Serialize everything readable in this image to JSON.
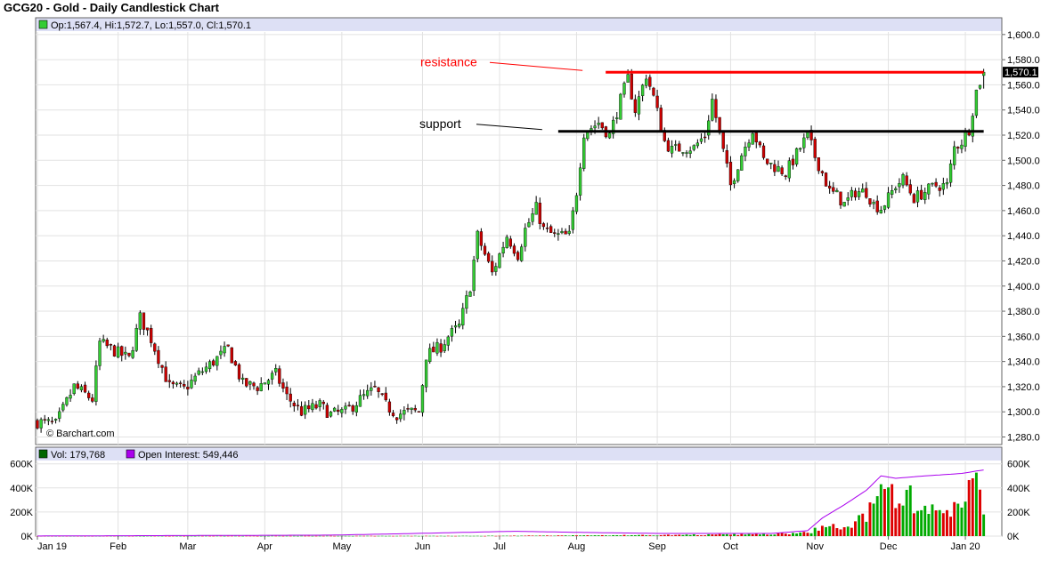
{
  "chart_data": {
    "type": "candlestick",
    "title": "GCG20 - Gold - Daily Candlestick Chart",
    "ohlc_label": "Op:1,567.4, Hi:1,572.7, Lo:1,557.0, Cl:1,570.1",
    "last_price_label": "1,570.1",
    "last_price": 1570.1,
    "watermark": "© Barchart.com",
    "y_ticks": [
      1280,
      1300,
      1320,
      1340,
      1360,
      1380,
      1400,
      1420,
      1440,
      1460,
      1480,
      1500,
      1520,
      1540,
      1560,
      1580,
      1600
    ],
    "y_tick_labels": [
      "1,280.0",
      "1,300.0",
      "1,320.0",
      "1,340.0",
      "1,360.0",
      "1,380.0",
      "1,400.0",
      "1,420.0",
      "1,440.0",
      "1,460.0",
      "1,480.0",
      "1,500.0",
      "1,520.0",
      "1,540.0",
      "1,560.0",
      "1,580.0",
      "1,600.0"
    ],
    "ylim": [
      1274,
      1602
    ],
    "x_labels": [
      "Jan 19",
      "Feb",
      "Mar",
      "Apr",
      "May",
      "Jun",
      "Jul",
      "Aug",
      "Sep",
      "Oct",
      "Nov",
      "Dec",
      "Jan 20"
    ],
    "x_label_days": [
      0,
      22,
      41,
      62,
      83,
      105,
      126,
      147,
      169,
      189,
      212,
      232,
      253
    ],
    "x_range_days": [
      0,
      261
    ],
    "anchors": [
      [
        0,
        1292
      ],
      [
        5,
        1290
      ],
      [
        10,
        1320
      ],
      [
        15,
        1310
      ],
      [
        17,
        1355
      ],
      [
        20,
        1350
      ],
      [
        25,
        1342
      ],
      [
        28,
        1375
      ],
      [
        31,
        1358
      ],
      [
        36,
        1320
      ],
      [
        40,
        1318
      ],
      [
        44,
        1330
      ],
      [
        48,
        1340
      ],
      [
        52,
        1350
      ],
      [
        56,
        1322
      ],
      [
        60,
        1320
      ],
      [
        65,
        1330
      ],
      [
        68,
        1312
      ],
      [
        72,
        1300
      ],
      [
        77,
        1305
      ],
      [
        80,
        1298
      ],
      [
        84,
        1300
      ],
      [
        88,
        1310
      ],
      [
        92,
        1318
      ],
      [
        95,
        1305
      ],
      [
        98,
        1298
      ],
      [
        101,
        1300
      ],
      [
        104,
        1300
      ],
      [
        106,
        1345
      ],
      [
        110,
        1352
      ],
      [
        112,
        1360
      ],
      [
        115,
        1368
      ],
      [
        118,
        1400
      ],
      [
        120,
        1440
      ],
      [
        124,
        1410
      ],
      [
        128,
        1440
      ],
      [
        131,
        1425
      ],
      [
        133,
        1445
      ],
      [
        136,
        1462
      ],
      [
        138,
        1445
      ],
      [
        141,
        1440
      ],
      [
        145,
        1440
      ],
      [
        147,
        1475
      ],
      [
        149,
        1522
      ],
      [
        153,
        1530
      ],
      [
        156,
        1520
      ],
      [
        159,
        1548
      ],
      [
        161,
        1565
      ],
      [
        163,
        1540
      ],
      [
        166,
        1568
      ],
      [
        168,
        1550
      ],
      [
        171,
        1515
      ],
      [
        173,
        1508
      ],
      [
        176,
        1510
      ],
      [
        179,
        1510
      ],
      [
        182,
        1520
      ],
      [
        184,
        1548
      ],
      [
        186,
        1520
      ],
      [
        189,
        1480
      ],
      [
        192,
        1505
      ],
      [
        195,
        1525
      ],
      [
        198,
        1500
      ],
      [
        201,
        1495
      ],
      [
        204,
        1490
      ],
      [
        208,
        1510
      ],
      [
        210,
        1520
      ],
      [
        212,
        1503
      ],
      [
        214,
        1490
      ],
      [
        216,
        1475
      ],
      [
        218,
        1472
      ],
      [
        220,
        1465
      ],
      [
        223,
        1475
      ],
      [
        226,
        1475
      ],
      [
        228,
        1465
      ],
      [
        230,
        1462
      ],
      [
        232,
        1470
      ],
      [
        234,
        1480
      ],
      [
        236,
        1485
      ],
      [
        239,
        1470
      ],
      [
        242,
        1475
      ],
      [
        245,
        1480
      ],
      [
        248,
        1480
      ],
      [
        250,
        1510
      ],
      [
        252,
        1515
      ],
      [
        254,
        1525
      ],
      [
        256,
        1555
      ],
      [
        258,
        1570
      ]
    ],
    "last_candle": {
      "open": 1567.4,
      "high": 1572.7,
      "low": 1557.0,
      "close": 1570.1
    },
    "annotations": [
      {
        "text": "resistance",
        "level": 1570,
        "from_day": 153,
        "to_day": 258,
        "color": "#ff0000"
      },
      {
        "text": "support",
        "level": 1523,
        "from_day": 142,
        "to_day": 258,
        "color": "#000000"
      }
    ],
    "volume": {
      "label": "Vol: 179,768",
      "last_value": 179768,
      "y_ticks": [
        0,
        200000,
        400000,
        600000
      ],
      "y_tick_labels": [
        "0K",
        "200K",
        "400K",
        "600K"
      ],
      "ylim": [
        0,
        620000
      ],
      "anchors": [
        [
          0,
          1000
        ],
        [
          120,
          2000
        ],
        [
          147,
          6000
        ],
        [
          170,
          9000
        ],
        [
          200,
          16000
        ],
        [
          210,
          28000
        ],
        [
          214,
          80000
        ],
        [
          218,
          75000
        ],
        [
          220,
          90000
        ],
        [
          222,
          80000
        ],
        [
          225,
          170000
        ],
        [
          228,
          240000
        ],
        [
          230,
          330000
        ],
        [
          232,
          380000
        ],
        [
          234,
          300000
        ],
        [
          236,
          420000
        ],
        [
          238,
          330000
        ],
        [
          240,
          250000
        ],
        [
          242,
          280000
        ],
        [
          244,
          200000
        ],
        [
          246,
          250000
        ],
        [
          248,
          220000
        ],
        [
          250,
          240000
        ],
        [
          252,
          340000
        ],
        [
          254,
          480000
        ],
        [
          256,
          650000
        ]
      ],
      "oi_label": "Open Interest: 549,446",
      "oi_last": 549446,
      "oi_anchors": [
        [
          0,
          1000
        ],
        [
          80,
          8000
        ],
        [
          100,
          20000
        ],
        [
          130,
          40000
        ],
        [
          150,
          30000
        ],
        [
          170,
          22000
        ],
        [
          200,
          22000
        ],
        [
          210,
          45000
        ],
        [
          214,
          150000
        ],
        [
          220,
          260000
        ],
        [
          226,
          380000
        ],
        [
          230,
          500000
        ],
        [
          234,
          480000
        ],
        [
          242,
          500000
        ],
        [
          252,
          520000
        ],
        [
          256,
          540000
        ],
        [
          258,
          549446
        ]
      ],
      "colors": {
        "up": "#00aa00",
        "down": "#dd0000",
        "oi": "#aa00ee"
      }
    },
    "colors": {
      "up": "#33cc33",
      "down": "#cc0000",
      "panel_header": "#dde0f5"
    }
  }
}
